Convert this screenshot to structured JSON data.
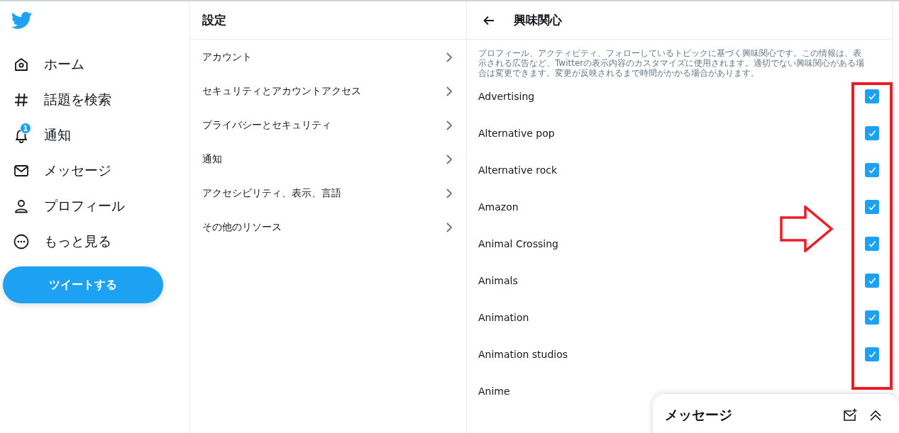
{
  "nav": {
    "items": [
      {
        "label": "ホーム"
      },
      {
        "label": "話題を検索"
      },
      {
        "label": "通知",
        "badge": "1"
      },
      {
        "label": "メッセージ"
      },
      {
        "label": "プロフィール"
      },
      {
        "label": "もっと見る"
      }
    ],
    "tweet_button": "ツイートする"
  },
  "settings": {
    "title": "設定",
    "items": [
      "アカウント",
      "セキュリティとアカウントアクセス",
      "プライバシーとセキュリティ",
      "通知",
      "アクセシビリティ、表示、言語",
      "その他のリソース"
    ]
  },
  "interests": {
    "title": "興味関心",
    "description": "プロフィール、アクティビティ、フォローしているトピックに基づく興味関心です。この情報は、表示される広告など、Twitterの表示内容のカスタマイズに使用されます。適切でない興味関心がある場合は変更できます。変更が反映されるまで時間がかかる場合があります。",
    "items": [
      {
        "label": "Advertising",
        "checked": true
      },
      {
        "label": "Alternative pop",
        "checked": true
      },
      {
        "label": "Alternative rock",
        "checked": true
      },
      {
        "label": "Amazon",
        "checked": true
      },
      {
        "label": "Animal Crossing",
        "checked": true
      },
      {
        "label": "Animals",
        "checked": true
      },
      {
        "label": "Animation",
        "checked": true
      },
      {
        "label": "Animation studios",
        "checked": true
      },
      {
        "label": "Anime"
      }
    ]
  },
  "messages_drawer": {
    "title": "メッセージ"
  }
}
